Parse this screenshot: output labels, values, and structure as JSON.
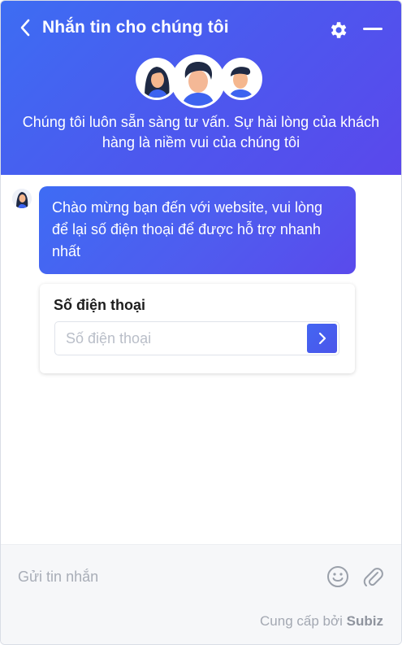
{
  "header": {
    "title": "Nhắn tin cho chúng tôi",
    "subtitle": "Chúng tôi luôn sẵn sàng tư vấn. Sự hài lòng của khách hàng là niềm vui của chúng tôi",
    "back_icon": "chevron-left-icon",
    "settings_icon": "gear-icon",
    "minimize_icon": "minus-icon"
  },
  "chat": {
    "greeting": "Chào mừng bạn đến với website, vui lòng để lại số điện thoại để được hỗ trợ nhanh nhất",
    "phone_form": {
      "label": "Số điện thoại",
      "placeholder": "Số điện thoại",
      "submit_icon": "chevron-right-icon"
    }
  },
  "composer": {
    "placeholder": "Gửi tin nhắn",
    "emoji_icon": "smiley-icon",
    "attach_icon": "paperclip-icon"
  },
  "footer": {
    "powered_prefix": "Cung cấp bởi",
    "brand": "Subiz"
  },
  "colors": {
    "accent": "#4a5cef",
    "accent_light": "#3d6df3",
    "footer_bg": "#f6f7f9"
  }
}
